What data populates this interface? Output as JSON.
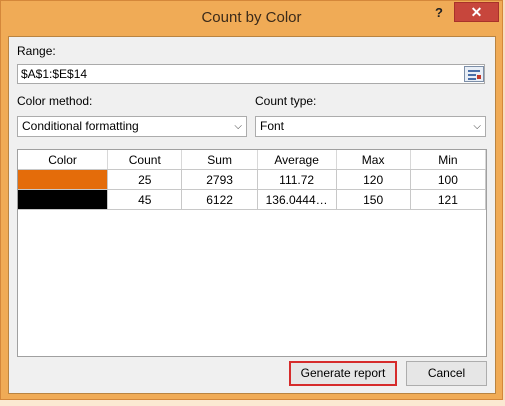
{
  "window": {
    "title": "Count by Color",
    "help_label": "?",
    "close_label": "✕"
  },
  "range": {
    "label": "Range:",
    "value": "$A$1:$E$14",
    "picker_icon": "range-select-icon"
  },
  "color_method": {
    "label": "Color method:",
    "selected": "Conditional formatting"
  },
  "count_type": {
    "label": "Count type:",
    "selected": "Font"
  },
  "table": {
    "columns": [
      "Color",
      "Count",
      "Sum",
      "Average",
      "Max",
      "Min"
    ],
    "rows": [
      {
        "color": "#e46c0a",
        "count": "25",
        "sum": "2793",
        "average": "111.72",
        "max": "120",
        "min": "100"
      },
      {
        "color": "#000000",
        "count": "45",
        "sum": "6122",
        "average": "136.0444…",
        "max": "150",
        "min": "121"
      }
    ]
  },
  "buttons": {
    "generate": "Generate report",
    "cancel": "Cancel"
  },
  "colors": {
    "frame": "#f0ab56",
    "close_button": "#c7463c",
    "highlight_border": "#d62b2b"
  }
}
